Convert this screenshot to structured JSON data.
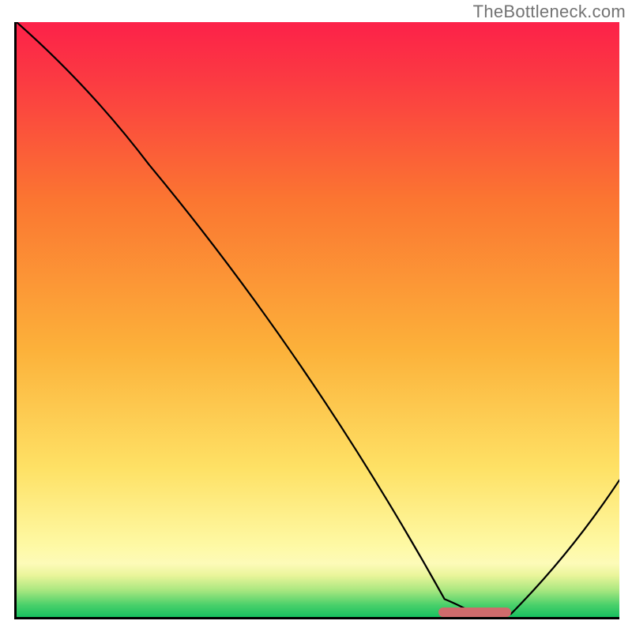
{
  "watermark": "TheBottleneck.com",
  "chart_data": {
    "type": "line",
    "title": "",
    "xlabel": "",
    "ylabel": "",
    "xlim": [
      0,
      100
    ],
    "ylim": [
      0,
      100
    ],
    "grid": false,
    "series": [
      {
        "name": "curve",
        "x": [
          0,
          22,
          71,
          76,
          82,
          100
        ],
        "y": [
          100,
          76,
          3,
          0.5,
          0.5,
          23
        ]
      }
    ],
    "marker": {
      "x_start": 70,
      "x_end": 82,
      "y": 0.8
    },
    "gradient_stops": [
      {
        "offset": 0,
        "color": "#18c060"
      },
      {
        "offset": 0.02,
        "color": "#49d06a"
      },
      {
        "offset": 0.045,
        "color": "#a9e780"
      },
      {
        "offset": 0.07,
        "color": "#eaf59a"
      },
      {
        "offset": 0.09,
        "color": "#fdfbb8"
      },
      {
        "offset": 0.12,
        "color": "#fef9a4"
      },
      {
        "offset": 0.25,
        "color": "#fee165"
      },
      {
        "offset": 0.45,
        "color": "#fcb13a"
      },
      {
        "offset": 0.7,
        "color": "#fb7631"
      },
      {
        "offset": 0.9,
        "color": "#fb3b42"
      },
      {
        "offset": 1.0,
        "color": "#fc2149"
      }
    ]
  }
}
